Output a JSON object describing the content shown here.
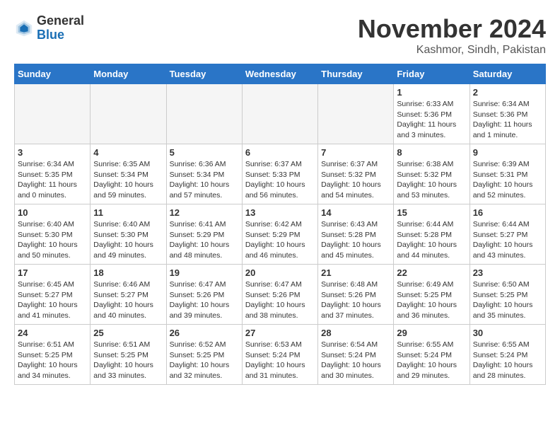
{
  "header": {
    "logo_line1": "General",
    "logo_line2": "Blue",
    "month_title": "November 2024",
    "location": "Kashmor, Sindh, Pakistan"
  },
  "weekdays": [
    "Sunday",
    "Monday",
    "Tuesday",
    "Wednesday",
    "Thursday",
    "Friday",
    "Saturday"
  ],
  "weeks": [
    [
      {
        "day": "",
        "info": ""
      },
      {
        "day": "",
        "info": ""
      },
      {
        "day": "",
        "info": ""
      },
      {
        "day": "",
        "info": ""
      },
      {
        "day": "",
        "info": ""
      },
      {
        "day": "1",
        "info": "Sunrise: 6:33 AM\nSunset: 5:36 PM\nDaylight: 11 hours and 3 minutes."
      },
      {
        "day": "2",
        "info": "Sunrise: 6:34 AM\nSunset: 5:36 PM\nDaylight: 11 hours and 1 minute."
      }
    ],
    [
      {
        "day": "3",
        "info": "Sunrise: 6:34 AM\nSunset: 5:35 PM\nDaylight: 11 hours and 0 minutes."
      },
      {
        "day": "4",
        "info": "Sunrise: 6:35 AM\nSunset: 5:34 PM\nDaylight: 10 hours and 59 minutes."
      },
      {
        "day": "5",
        "info": "Sunrise: 6:36 AM\nSunset: 5:34 PM\nDaylight: 10 hours and 57 minutes."
      },
      {
        "day": "6",
        "info": "Sunrise: 6:37 AM\nSunset: 5:33 PM\nDaylight: 10 hours and 56 minutes."
      },
      {
        "day": "7",
        "info": "Sunrise: 6:37 AM\nSunset: 5:32 PM\nDaylight: 10 hours and 54 minutes."
      },
      {
        "day": "8",
        "info": "Sunrise: 6:38 AM\nSunset: 5:32 PM\nDaylight: 10 hours and 53 minutes."
      },
      {
        "day": "9",
        "info": "Sunrise: 6:39 AM\nSunset: 5:31 PM\nDaylight: 10 hours and 52 minutes."
      }
    ],
    [
      {
        "day": "10",
        "info": "Sunrise: 6:40 AM\nSunset: 5:30 PM\nDaylight: 10 hours and 50 minutes."
      },
      {
        "day": "11",
        "info": "Sunrise: 6:40 AM\nSunset: 5:30 PM\nDaylight: 10 hours and 49 minutes."
      },
      {
        "day": "12",
        "info": "Sunrise: 6:41 AM\nSunset: 5:29 PM\nDaylight: 10 hours and 48 minutes."
      },
      {
        "day": "13",
        "info": "Sunrise: 6:42 AM\nSunset: 5:29 PM\nDaylight: 10 hours and 46 minutes."
      },
      {
        "day": "14",
        "info": "Sunrise: 6:43 AM\nSunset: 5:28 PM\nDaylight: 10 hours and 45 minutes."
      },
      {
        "day": "15",
        "info": "Sunrise: 6:44 AM\nSunset: 5:28 PM\nDaylight: 10 hours and 44 minutes."
      },
      {
        "day": "16",
        "info": "Sunrise: 6:44 AM\nSunset: 5:27 PM\nDaylight: 10 hours and 43 minutes."
      }
    ],
    [
      {
        "day": "17",
        "info": "Sunrise: 6:45 AM\nSunset: 5:27 PM\nDaylight: 10 hours and 41 minutes."
      },
      {
        "day": "18",
        "info": "Sunrise: 6:46 AM\nSunset: 5:27 PM\nDaylight: 10 hours and 40 minutes."
      },
      {
        "day": "19",
        "info": "Sunrise: 6:47 AM\nSunset: 5:26 PM\nDaylight: 10 hours and 39 minutes."
      },
      {
        "day": "20",
        "info": "Sunrise: 6:47 AM\nSunset: 5:26 PM\nDaylight: 10 hours and 38 minutes."
      },
      {
        "day": "21",
        "info": "Sunrise: 6:48 AM\nSunset: 5:26 PM\nDaylight: 10 hours and 37 minutes."
      },
      {
        "day": "22",
        "info": "Sunrise: 6:49 AM\nSunset: 5:25 PM\nDaylight: 10 hours and 36 minutes."
      },
      {
        "day": "23",
        "info": "Sunrise: 6:50 AM\nSunset: 5:25 PM\nDaylight: 10 hours and 35 minutes."
      }
    ],
    [
      {
        "day": "24",
        "info": "Sunrise: 6:51 AM\nSunset: 5:25 PM\nDaylight: 10 hours and 34 minutes."
      },
      {
        "day": "25",
        "info": "Sunrise: 6:51 AM\nSunset: 5:25 PM\nDaylight: 10 hours and 33 minutes."
      },
      {
        "day": "26",
        "info": "Sunrise: 6:52 AM\nSunset: 5:25 PM\nDaylight: 10 hours and 32 minutes."
      },
      {
        "day": "27",
        "info": "Sunrise: 6:53 AM\nSunset: 5:24 PM\nDaylight: 10 hours and 31 minutes."
      },
      {
        "day": "28",
        "info": "Sunrise: 6:54 AM\nSunset: 5:24 PM\nDaylight: 10 hours and 30 minutes."
      },
      {
        "day": "29",
        "info": "Sunrise: 6:55 AM\nSunset: 5:24 PM\nDaylight: 10 hours and 29 minutes."
      },
      {
        "day": "30",
        "info": "Sunrise: 6:55 AM\nSunset: 5:24 PM\nDaylight: 10 hours and 28 minutes."
      }
    ]
  ]
}
